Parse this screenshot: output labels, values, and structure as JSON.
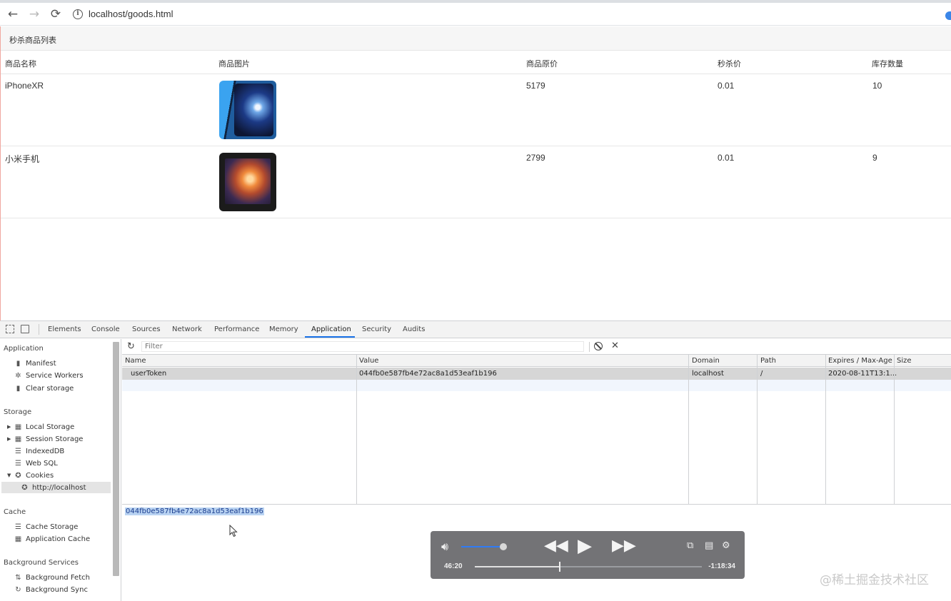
{
  "browser": {
    "url": "localhost/goods.html",
    "back_icon": "←",
    "forward_icon": "→",
    "reload_icon": "⟳",
    "info_icon": "i"
  },
  "page": {
    "title": "秒杀商品列表",
    "headers": [
      "商品名称",
      "商品图片",
      "商品原价",
      "秒杀价",
      "库存数量"
    ],
    "rows": [
      {
        "name": "iPhoneXR",
        "image": "iphone-xr-photo",
        "price": "5179",
        "seckill_price": "0.01",
        "stock": "10"
      },
      {
        "name": "小米手机",
        "image": "xiaomi-phone-photo",
        "price": "2799",
        "seckill_price": "0.01",
        "stock": "9"
      }
    ]
  },
  "devtools": {
    "tabs": [
      "Elements",
      "Console",
      "Sources",
      "Network",
      "Performance",
      "Memory",
      "Application",
      "Security",
      "Audits"
    ],
    "active_tab": "Application",
    "sidebar": {
      "application_heading": "Application",
      "application_items": [
        "Manifest",
        "Service Workers",
        "Clear storage"
      ],
      "storage_heading": "Storage",
      "storage_items": [
        "Local Storage",
        "Session Storage",
        "IndexedDB",
        "Web SQL",
        "Cookies"
      ],
      "cookie_origin": "http://localhost",
      "cache_heading": "Cache",
      "cache_items": [
        "Cache Storage",
        "Application Cache"
      ],
      "bg_heading": "Background Services",
      "bg_items": [
        "Background Fetch",
        "Background Sync"
      ]
    },
    "filter_placeholder": "Filter",
    "cookie_columns": [
      "Name",
      "Value",
      "Domain",
      "Path",
      "Expires / Max-Age",
      "Size"
    ],
    "cookie_row": {
      "name": "userToken",
      "value": "044fb0e587fb4e72ac8a1d53eaf1b196",
      "domain": "localhost",
      "path": "/",
      "expires": "2020-08-11T13:1..."
    },
    "value_preview": "044fb0e587fb4e72ac8a1d53eaf1b196"
  },
  "player": {
    "current_time": "46:20",
    "remaining_time": "-1:18:34",
    "volume_fraction": 0.95,
    "progress_fraction": 0.37,
    "accent_color": "#2f7bf5"
  },
  "watermark": "@稀土掘金技术社区"
}
